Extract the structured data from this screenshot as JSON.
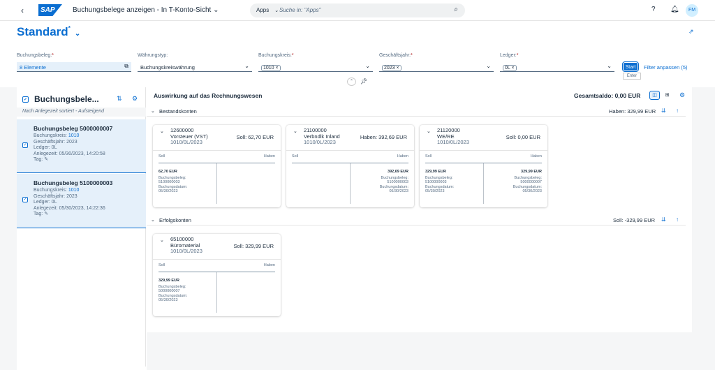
{
  "shell": {
    "title": "Buchungsbelege anzeigen - In T-Konto-Sicht",
    "search_scope": "Apps",
    "search_placeholder": "Suche in: \"Apps\"",
    "avatar": "FM",
    "logo": "SAP"
  },
  "variant": {
    "name": "Standard"
  },
  "filters": [
    {
      "label": "Buchungsbeleg:",
      "value": "8 Elemente"
    },
    {
      "label": "Währungstyp:",
      "value": "Buchungskreiswährung"
    },
    {
      "label": "Buchungskreis:",
      "token": "1010"
    },
    {
      "label": "Geschäftsjahr:",
      "token": "2023"
    },
    {
      "label": "Ledger:",
      "token": "0L"
    }
  ],
  "buttons": {
    "start": "Start",
    "start_tooltip": "Enter",
    "adapt": "Filter anpassen (5)"
  },
  "list": {
    "title": "Buchungsbele...",
    "sort_info": "Nach Anlegezeit sortiert - Aufsteigend",
    "items": [
      {
        "title": "Buchungsbeleg 5000000007",
        "ck_label": "Buchungskreis:",
        "ck": "1010",
        "gj": "Geschäftsjahr: 2023",
        "ledger": "Ledger: 0L",
        "created": "Anlegezeit: 05/30/2023, 14:20:58",
        "tag": "Tag:"
      },
      {
        "title": "Buchungsbeleg 5100000003",
        "ck_label": "Buchungskreis:",
        "ck": "1010",
        "gj": "Geschäftsjahr: 2023",
        "ledger": "Ledger: 0L",
        "created": "Anlegezeit: 05/30/2023, 14:22:36",
        "tag": "Tag:"
      }
    ]
  },
  "main": {
    "title": "Auswirkung auf das Rechnungswesen",
    "total": "Gesamtsaldo: 0,00 EUR",
    "groups": [
      {
        "title": "Bestandskonten",
        "sum": "Haben: 329,99 EUR"
      },
      {
        "title": "Erfolgskonten",
        "sum": "Soll: -329,99 EUR"
      }
    ],
    "accounts": [
      {
        "num": "12600000",
        "name": "Vorsteuer (VST)",
        "sub": "1010/0L/2023",
        "balance": "Soll: 62,70 EUR",
        "soll": "Soll",
        "haben": "Haben",
        "left": {
          "amount": "62,70 EUR",
          "bl": "Buchungsbeleg:",
          "beleg": "5100000003",
          "dl": "Buchungsdatum:",
          "date": "05/30/2023"
        },
        "right": null
      },
      {
        "num": "21100000",
        "name": "Verbndlk Inland",
        "sub": "1010/0L/2023",
        "balance": "Haben: 392,69 EUR",
        "soll": "Soll",
        "haben": "Haben",
        "left": null,
        "right": {
          "amount": "392,69 EUR",
          "bl": "Buchungsbeleg:",
          "beleg": "5100000003",
          "dl": "Buchungsdatum:",
          "date": "05/30/2023"
        }
      },
      {
        "num": "21120000",
        "name": "WE/RE",
        "sub": "1010/0L/2023",
        "balance": "Soll: 0,00 EUR",
        "soll": "Soll",
        "haben": "Haben",
        "left": {
          "amount": "329,99 EUR",
          "bl": "Buchungsbeleg:",
          "beleg": "5100000003",
          "dl": "Buchungsdatum:",
          "date": "05/30/2023"
        },
        "right": {
          "amount": "329,99 EUR",
          "bl": "Buchungsbeleg:",
          "beleg": "5000000007",
          "dl": "Buchungsdatum:",
          "date": "05/30/2023"
        }
      },
      {
        "num": "65100000",
        "name": "Büromaterial",
        "sub": "1010/0L/2023",
        "balance": "Soll: 329,99 EUR",
        "soll": "Soll",
        "haben": "Haben",
        "left": {
          "amount": "329,99 EUR",
          "bl": "Buchungsbeleg:",
          "beleg": "5000000007",
          "dl": "Buchungsdatum:",
          "date": "05/30/2023"
        },
        "right": null
      }
    ]
  }
}
